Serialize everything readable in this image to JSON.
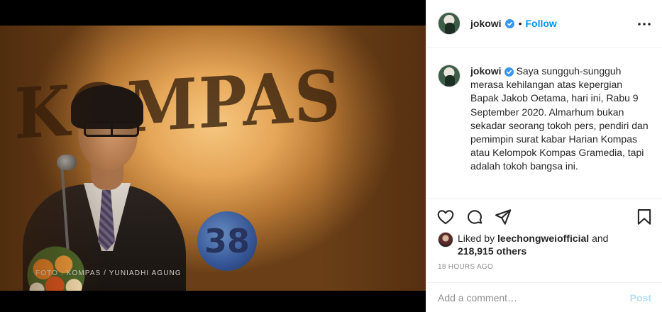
{
  "photo": {
    "sign_text": "KOMPAS",
    "logo_text": "38",
    "credit": "FOTO : KOMPAS / YUNIADHI AGUNG"
  },
  "header": {
    "username": "jokowi",
    "verified": true,
    "separator": "•",
    "follow_label": "Follow",
    "more_icon": "more-horizontal-icon"
  },
  "caption": {
    "username": "jokowi",
    "text": "Saya sungguh-sungguh merasa kehilangan atas kepergian Bapak Jakob Oetama, hari ini, Rabu 9 September 2020. Almarhum bukan sekadar seorang tokoh pers, pendiri dan pemimpin surat kabar Harian Kompas atau Kelompok Kompas Gramedia, tapi adalah tokoh bangsa ini."
  },
  "actions": {
    "icons": [
      "heart-icon",
      "comment-icon",
      "share-icon",
      "bookmark-icon"
    ]
  },
  "likes": {
    "prefix": "Liked by",
    "user": "leechongweiofficial",
    "and": "and",
    "others": "218,915 others"
  },
  "timestamp": "18 HOURS AGO",
  "comment": {
    "placeholder": "Add a comment…",
    "post_label": "Post"
  },
  "colors": {
    "accent": "#0095f6",
    "verified": "#3897f0",
    "post_disabled": "#b2dffc",
    "muted": "#8e8e8e"
  }
}
